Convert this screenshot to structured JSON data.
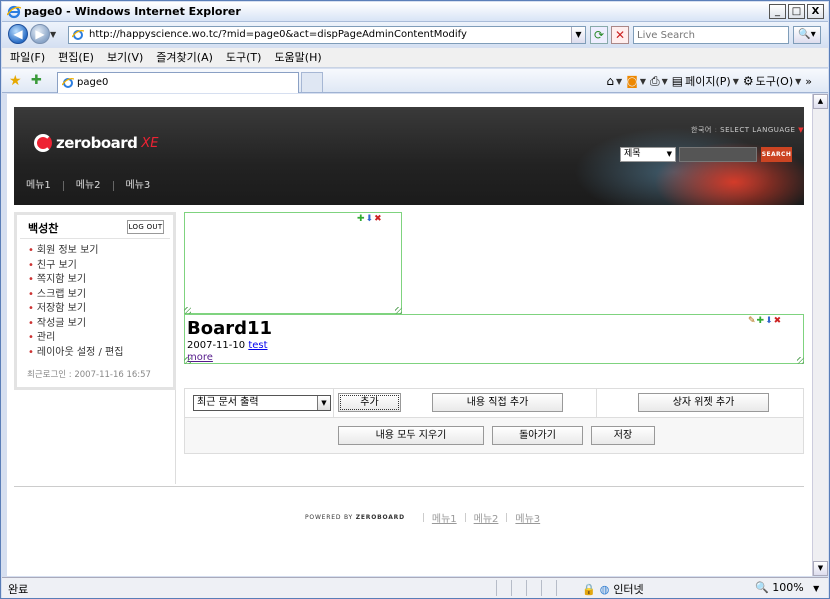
{
  "window": {
    "title": "page0 - Windows Internet Explorer",
    "minimize": "_",
    "maximize": "□",
    "close": "X"
  },
  "address": {
    "url": "http://happyscience.wo.tc/?mid=page0&act=dispPageAdminContentModify",
    "search_placeholder": "Live Search"
  },
  "menu": [
    "파일(F)",
    "편집(E)",
    "보기(V)",
    "즐겨찾기(A)",
    "도구(T)",
    "도움말(H)"
  ],
  "tab": {
    "label": "page0"
  },
  "commandbar": {
    "page": "페이지(P)",
    "tools": "도구(O)"
  },
  "header": {
    "logo_text": "zeroboard",
    "logo_suffix": "XE",
    "lang_current": "한국어",
    "lang_select": "SELECT LANGUAGE",
    "search_option": "제목",
    "search_button": "SEARCH",
    "nav": [
      "메뉴1",
      "메뉴2",
      "메뉴3"
    ]
  },
  "sidebar": {
    "user_name": "백성찬",
    "logout": "LOG OUT",
    "items": [
      "회원 정보 보기",
      "친구 보기",
      "쪽지함 보기",
      "스크랩 보기",
      "저장함 보기",
      "작성글 보기",
      "관리",
      "레이아웃 설정 / 편집"
    ],
    "last_login": "최근로그인 : 2007-11-16 16:57"
  },
  "board": {
    "title": "Board11",
    "date": "2007-11-10",
    "author": "test",
    "more": "more"
  },
  "toolbox": {
    "select_value": "최근 문서 출력",
    "add": "추가",
    "add_content": "내용 직접 추가",
    "add_box_widget": "상자 위젯 추가",
    "clear_all": "내용 모두 지우기",
    "back": "돌아가기",
    "save": "저장"
  },
  "footer": {
    "powered_prefix": "POWERED BY",
    "powered_brand": "ZEROBOARD",
    "links": [
      "메뉴1",
      "메뉴2",
      "메뉴3"
    ]
  },
  "status": {
    "text": "완료",
    "zone": "인터넷",
    "zoom": "100%"
  }
}
